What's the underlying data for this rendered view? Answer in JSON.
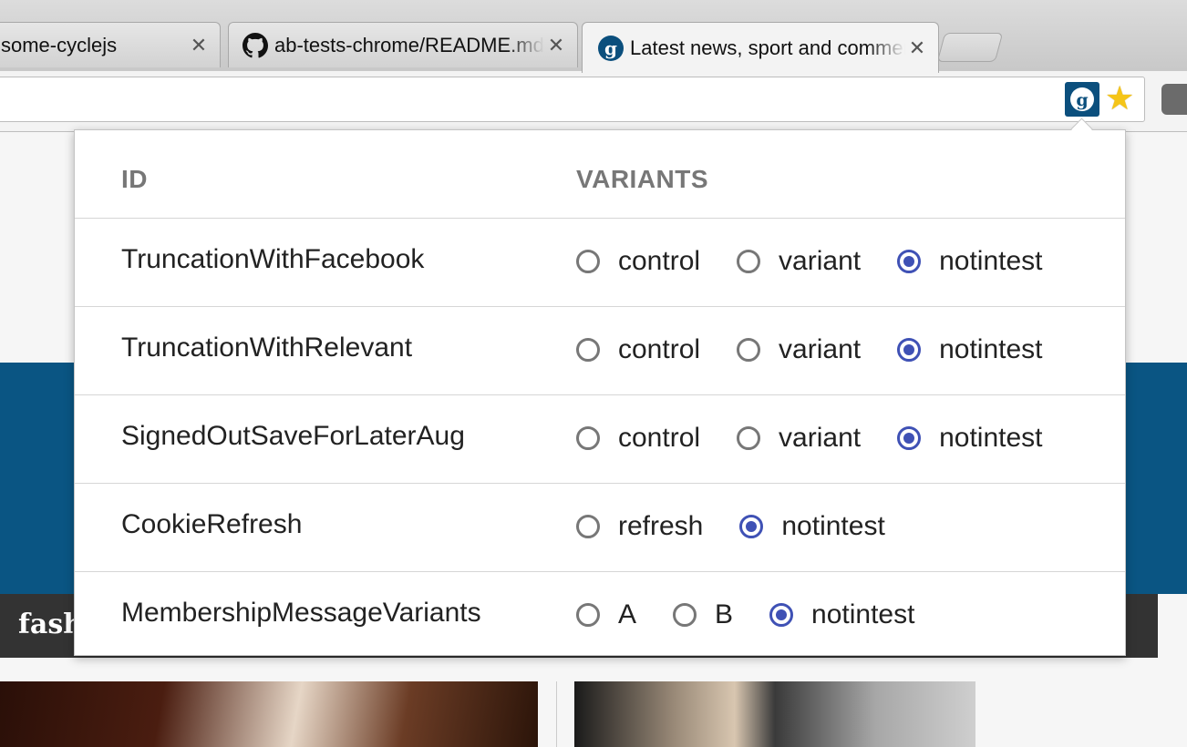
{
  "browser": {
    "tabs": [
      {
        "title": "some-cyclejs",
        "close": "✕",
        "icon": "none"
      },
      {
        "title": "ab-tests-chrome/README.md",
        "close": "✕",
        "icon": "github-icon"
      },
      {
        "title": "Latest news, sport and comment",
        "close": "✕",
        "icon": "guardian-icon",
        "active": true
      }
    ],
    "toolbar": {
      "extension_icon": "guardian-icon",
      "bookmark_icon": "star-icon",
      "pocket_icon": "pocket-icon"
    }
  },
  "page": {
    "nav_label": "fash"
  },
  "popup": {
    "headers": {
      "id": "ID",
      "variants": "VARIANTS"
    },
    "tests": [
      {
        "id": "TruncationWithFacebook",
        "variants": [
          {
            "label": "control",
            "selected": false
          },
          {
            "label": "variant",
            "selected": false
          },
          {
            "label": "notintest",
            "selected": true
          }
        ]
      },
      {
        "id": "TruncationWithRelevant",
        "variants": [
          {
            "label": "control",
            "selected": false
          },
          {
            "label": "variant",
            "selected": false
          },
          {
            "label": "notintest",
            "selected": true
          }
        ]
      },
      {
        "id": "SignedOutSaveForLaterAug",
        "variants": [
          {
            "label": "control",
            "selected": false
          },
          {
            "label": "variant",
            "selected": false
          },
          {
            "label": "notintest",
            "selected": true
          }
        ]
      },
      {
        "id": "CookieRefresh",
        "variants": [
          {
            "label": "refresh",
            "selected": false
          },
          {
            "label": "notintest",
            "selected": true
          }
        ]
      },
      {
        "id": "MembershipMessageVariants",
        "variants": [
          {
            "label": "A",
            "selected": false
          },
          {
            "label": "B",
            "selected": false
          },
          {
            "label": "notintest",
            "selected": true
          }
        ]
      }
    ]
  },
  "colors": {
    "accent": "#3f51b5",
    "guardian_blue": "#0a5583"
  }
}
